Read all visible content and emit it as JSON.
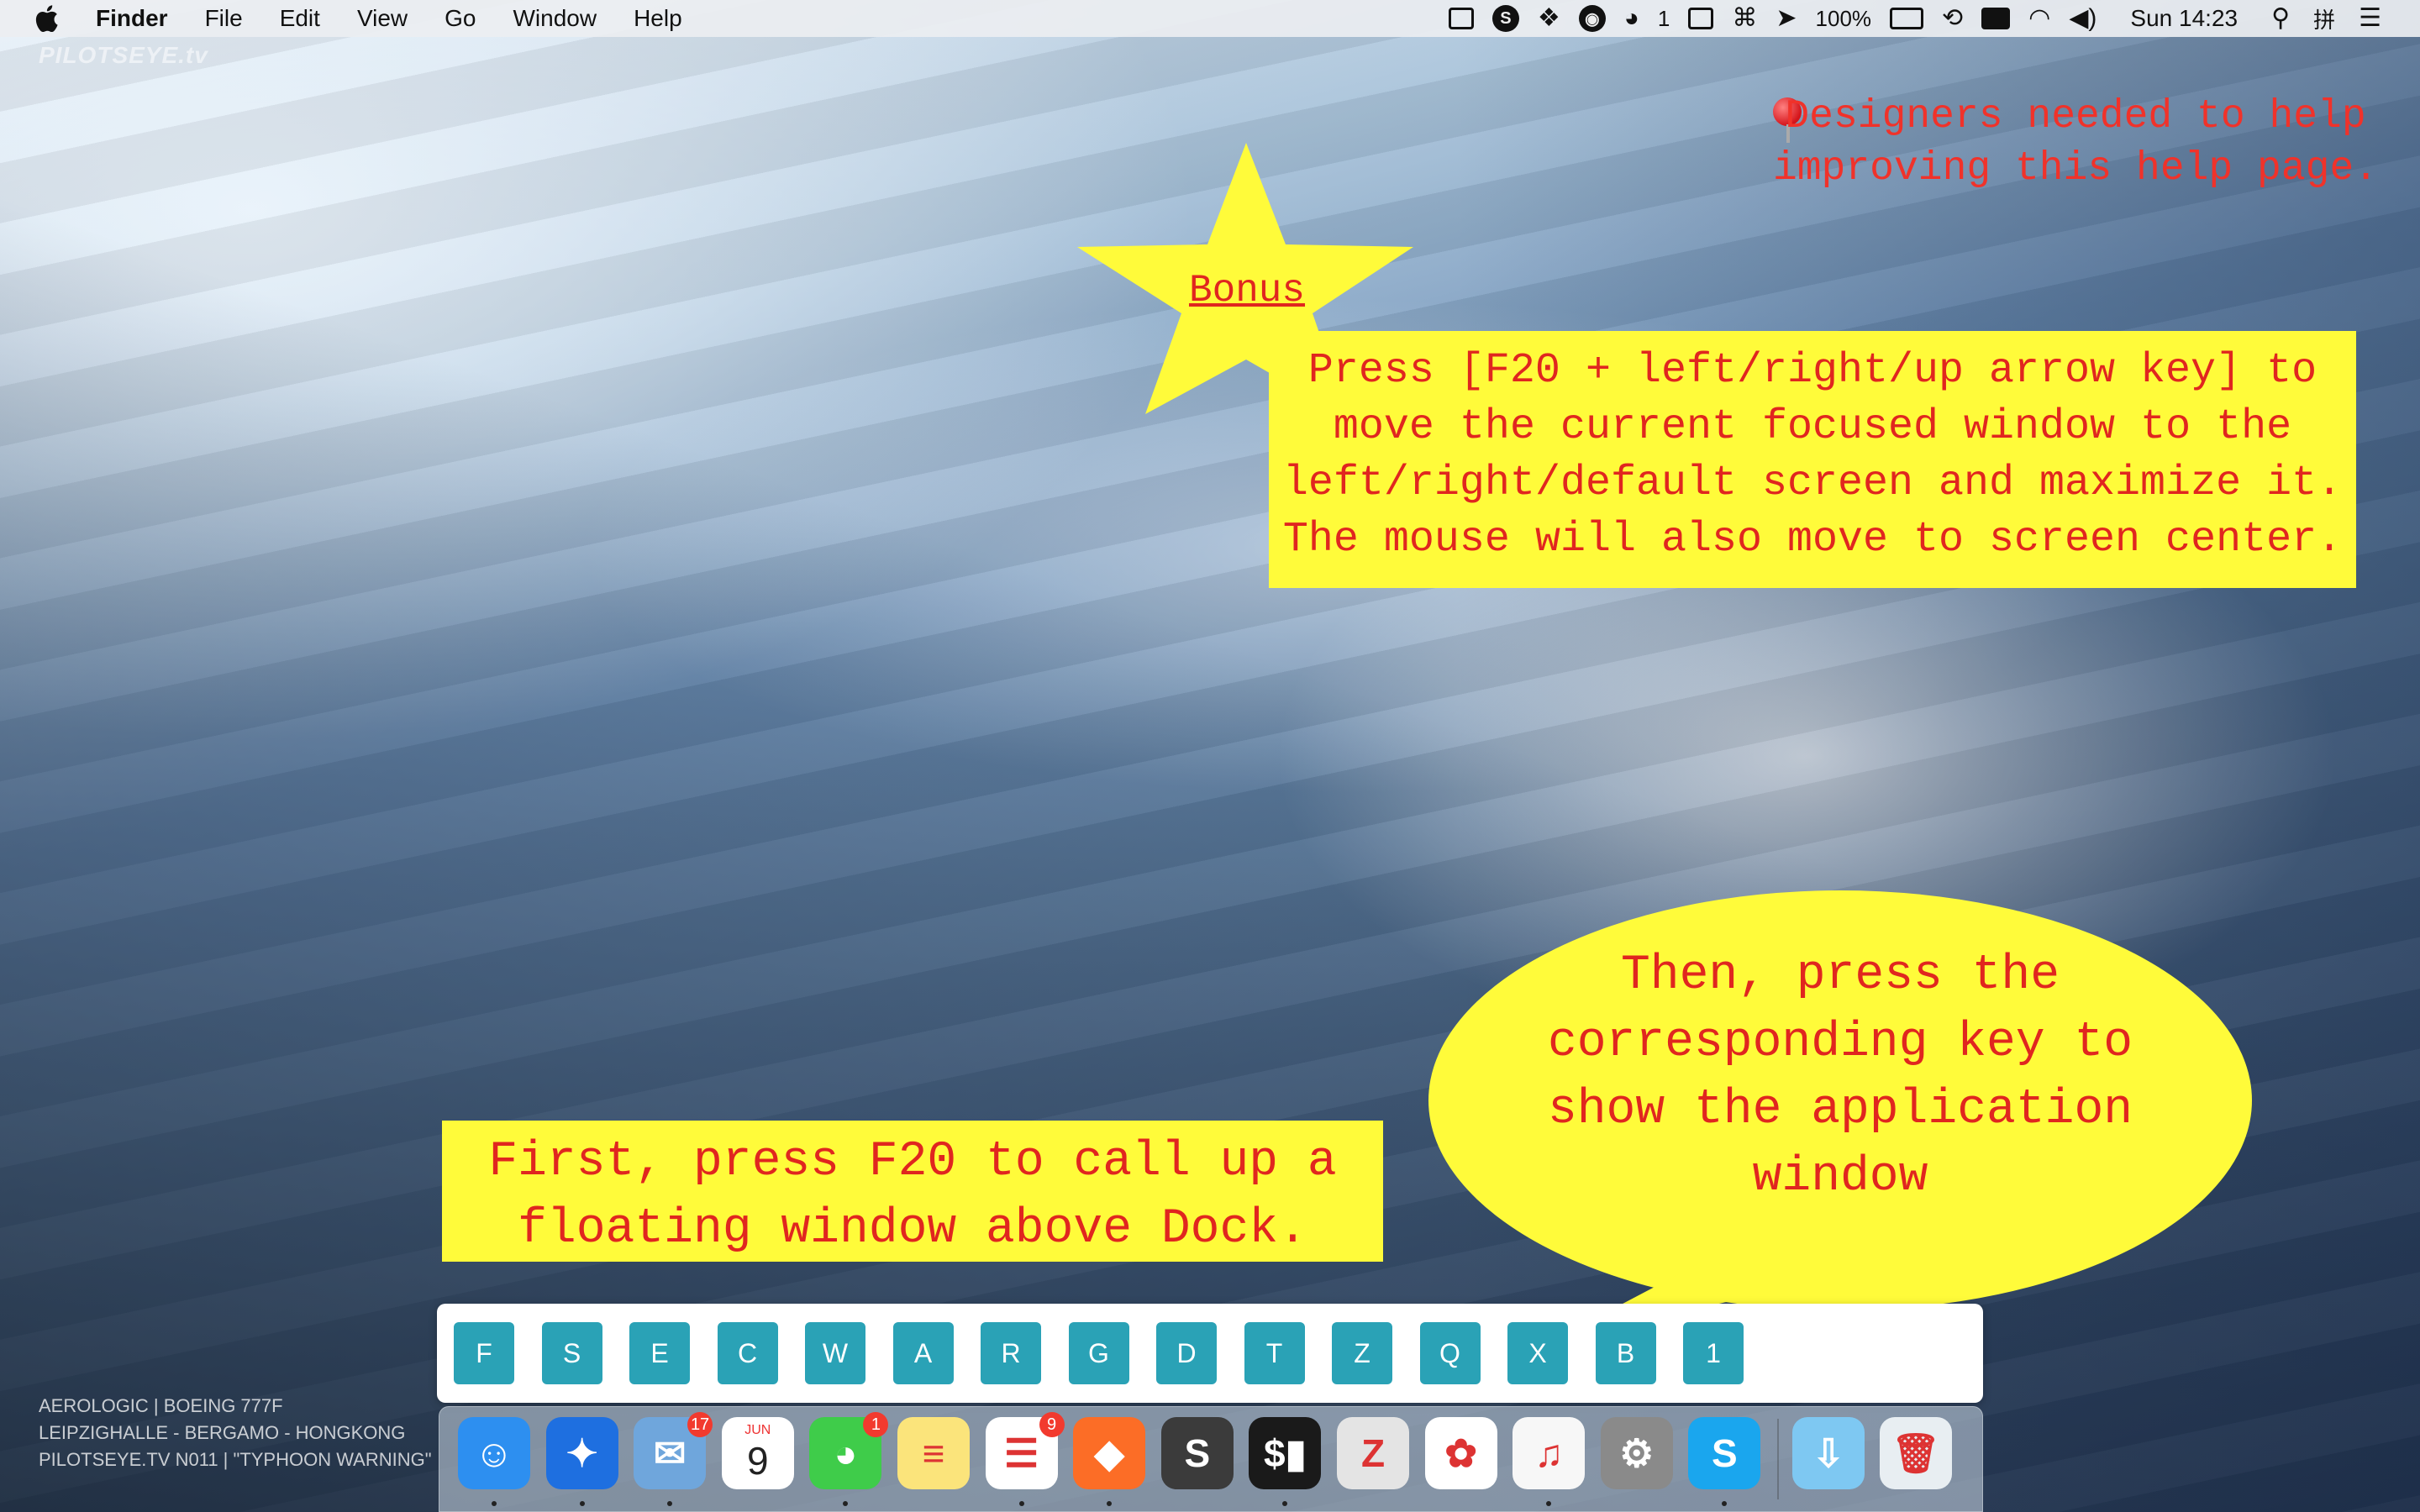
{
  "menubar": {
    "app_name": "Finder",
    "menus": [
      "File",
      "Edit",
      "View",
      "Go",
      "Window",
      "Help"
    ],
    "status": {
      "wechat_count": "1",
      "command_glyph": "⌘",
      "battery": "100%",
      "clock": "Sun 14:23",
      "input_method": "拼"
    }
  },
  "wallpaper": {
    "watermark": "PILOTSEYE.tv",
    "caption": [
      "AEROLOGIC | BOEING 777F",
      "LEIPZIGHALLE - BERGAMO - HONGKONG",
      "PILOTSEYE.TV N011 | \"TYPHOON WARNING\""
    ]
  },
  "note": {
    "lines": [
      "Designers needed to help",
      "improving this help page."
    ]
  },
  "bonus": {
    "label": "Bonus",
    "lines": [
      "Press [F20 + left/right/up arrow key] to",
      "move the current focused window to the",
      "left/right/default screen and maximize it.",
      "The mouse will also move to screen center."
    ]
  },
  "first_step": {
    "lines": [
      "First, press F20 to call up a",
      "floating window above Dock."
    ]
  },
  "second_step": {
    "lines": [
      "Then, press the",
      "corresponding key to",
      "show the application",
      "window"
    ]
  },
  "keybar": {
    "keys": [
      "F",
      "S",
      "E",
      "C",
      "W",
      "A",
      "R",
      "G",
      "D",
      "T",
      "Z",
      "Q",
      "X",
      "B",
      "1"
    ]
  },
  "dock": {
    "apps": [
      {
        "name": "Finder",
        "icon": "finder-icon",
        "color": "#2d8ff0",
        "glyph": "☺"
      },
      {
        "name": "Safari",
        "icon": "safari-icon",
        "color": "#1e6fe0",
        "glyph": "✦"
      },
      {
        "name": "Mail",
        "icon": "mail-icon",
        "color": "#6fa6dc",
        "glyph": "✉",
        "badge": "17"
      },
      {
        "name": "Calendar",
        "icon": "calendar-icon",
        "color": "#ffffff",
        "glyph": "9",
        "month": "JUN"
      },
      {
        "name": "WeChat",
        "icon": "wechat-icon",
        "color": "#3fcc4a",
        "glyph": "◕",
        "badge": "1"
      },
      {
        "name": "Notes",
        "icon": "notes-icon",
        "color": "#fbe47b",
        "glyph": "≡"
      },
      {
        "name": "Reminders",
        "icon": "reminders-icon",
        "color": "#ffffff",
        "glyph": "☰",
        "badge": "9"
      },
      {
        "name": "GitLab",
        "icon": "gitlab-icon",
        "color": "#fc6d26",
        "glyph": "◆"
      },
      {
        "name": "Sublime Text",
        "icon": "sublime-icon",
        "color": "#3b3b3b",
        "glyph": "S"
      },
      {
        "name": "Terminal",
        "icon": "terminal-icon",
        "color": "#1a1a1a",
        "glyph": "$▮"
      },
      {
        "name": "Zotero",
        "icon": "zotero-icon",
        "color": "#e4e4e4",
        "glyph": "Z"
      },
      {
        "name": "Photos",
        "icon": "photos-icon",
        "color": "#ffffff",
        "glyph": "✿"
      },
      {
        "name": "iTunes",
        "icon": "itunes-icon",
        "color": "#f7f7f7",
        "glyph": "♫"
      },
      {
        "name": "System Preferences",
        "icon": "system-preferences-icon",
        "color": "#8a8a8a",
        "glyph": "⚙"
      },
      {
        "name": "Skype",
        "icon": "skype-icon",
        "color": "#1aa6ee",
        "glyph": "S"
      },
      {
        "name": "Downloads",
        "icon": "downloads-folder-icon",
        "color": "#7ec8f2",
        "glyph": "⇩"
      },
      {
        "name": "Trash",
        "icon": "trash-icon",
        "color": "#e8eef2",
        "glyph": "🗑"
      }
    ]
  }
}
